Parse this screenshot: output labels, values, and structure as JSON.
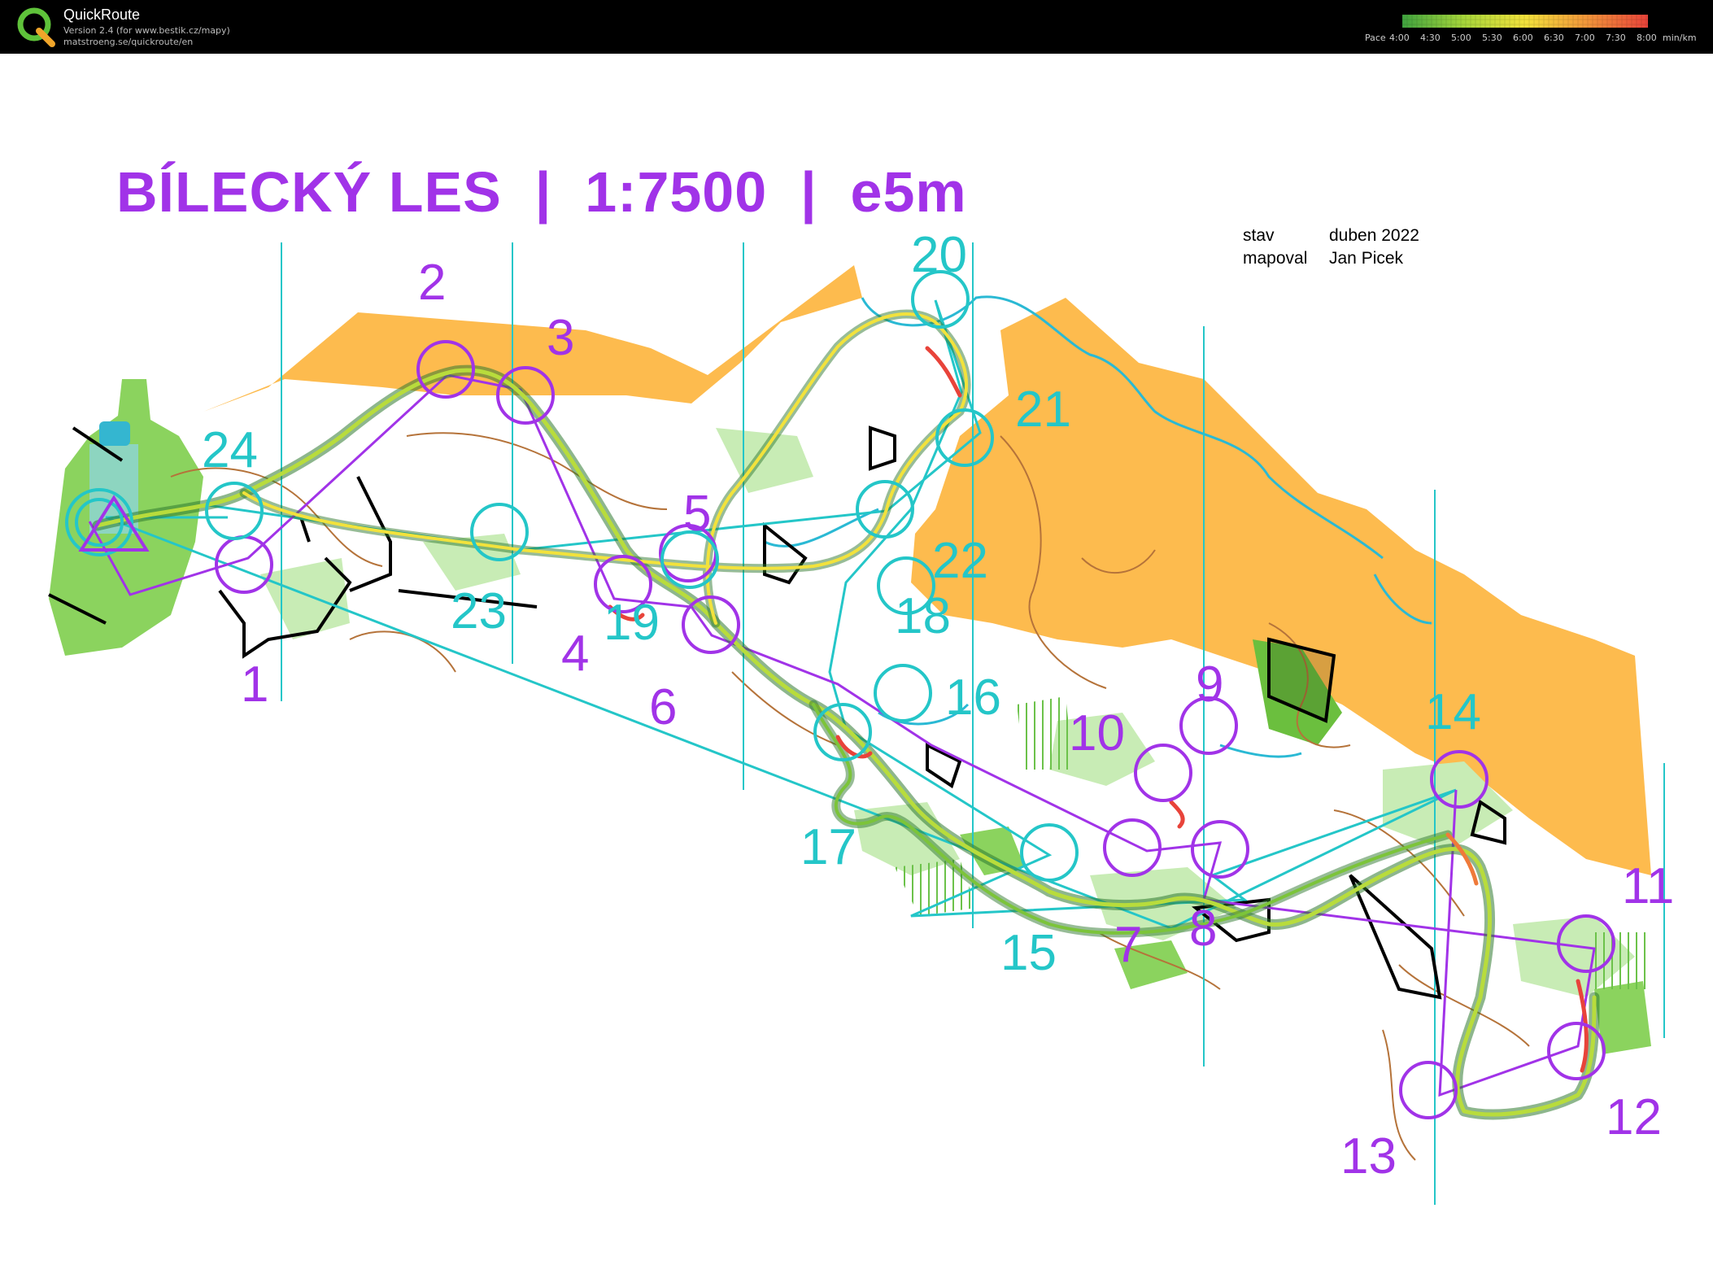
{
  "app": {
    "name": "QuickRoute",
    "version_line": "Version 2.4  (for www.bestik.cz/mapy)",
    "url_line": "matstroeng.se/quickroute/en",
    "logo_letter": "Q"
  },
  "pace_scale": {
    "label": "Pace",
    "ticks": [
      "4:00",
      "4:30",
      "5:00",
      "5:30",
      "6:00",
      "6:30",
      "7:00",
      "7:30",
      "8:00"
    ],
    "unit": "min/km",
    "colors": [
      "#3fa33f",
      "#7cc43a",
      "#b8dc3c",
      "#f2e23c",
      "#f4b63a",
      "#ef7a3a",
      "#e8433a"
    ]
  },
  "map": {
    "title": "BÍLECKÝ LES  |  1:7500  |  e5m",
    "info": {
      "status_label": "stav",
      "status_value": "duben 2022",
      "mapper_label": "mapoval",
      "mapper_value": "Jan Picek"
    },
    "colors": {
      "field": "#fdbb4e",
      "green": "#8bd35e",
      "light_green": "#c8ecb5",
      "course_purple": "#a133e8",
      "course_cyan": "#24c6c8",
      "contour": "#b5733a",
      "water": "#2ab9d4"
    }
  },
  "controls": [
    {
      "label": "1",
      "color": "purple"
    },
    {
      "label": "2",
      "color": "purple"
    },
    {
      "label": "3",
      "color": "purple"
    },
    {
      "label": "4",
      "color": "purple"
    },
    {
      "label": "5",
      "color": "purple"
    },
    {
      "label": "6",
      "color": "purple"
    },
    {
      "label": "7",
      "color": "purple"
    },
    {
      "label": "8",
      "color": "purple"
    },
    {
      "label": "9",
      "color": "purple"
    },
    {
      "label": "10",
      "color": "purple"
    },
    {
      "label": "11",
      "color": "purple"
    },
    {
      "label": "12",
      "color": "purple"
    },
    {
      "label": "13",
      "color": "purple"
    },
    {
      "label": "14",
      "color": "cyan"
    },
    {
      "label": "15",
      "color": "cyan"
    },
    {
      "label": "16",
      "color": "cyan"
    },
    {
      "label": "17",
      "color": "cyan"
    },
    {
      "label": "18",
      "color": "cyan"
    },
    {
      "label": "19",
      "color": "cyan"
    },
    {
      "label": "20",
      "color": "cyan"
    },
    {
      "label": "21",
      "color": "cyan"
    },
    {
      "label": "22",
      "color": "cyan"
    },
    {
      "label": "23",
      "color": "cyan"
    },
    {
      "label": "24",
      "color": "cyan"
    }
  ]
}
